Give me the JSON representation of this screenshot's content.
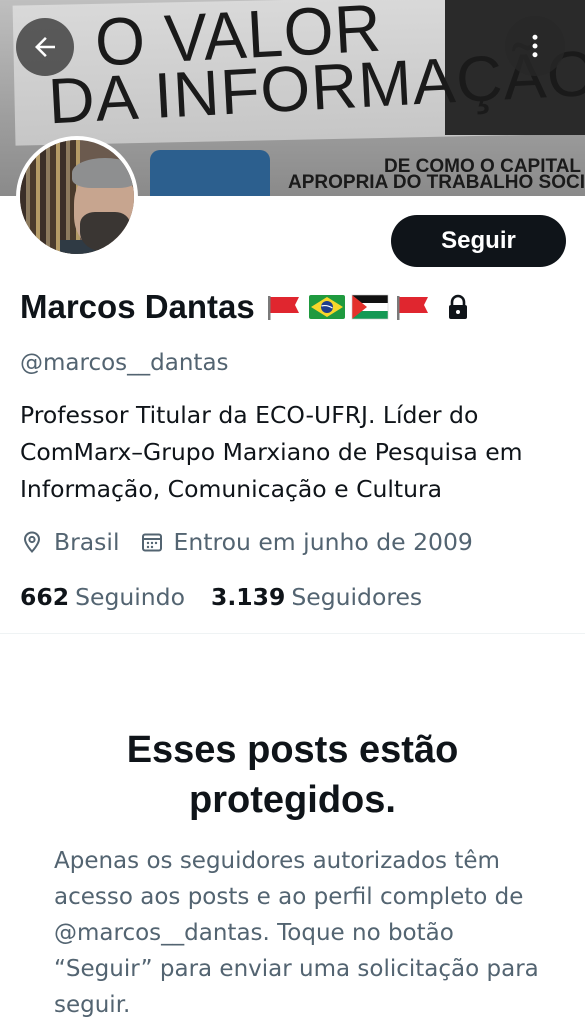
{
  "header": {
    "back_icon": "arrow-left-icon",
    "more_icon": "more-vertical-icon",
    "banner": {
      "line1": "O VALOR",
      "line2": "DA INFORMAÇÃO",
      "sub1": "DE COMO O CAPITAL SE",
      "sub2": "APROPRIA DO TRABALHO SOCIAL NA"
    }
  },
  "profile": {
    "follow_label": "Seguir",
    "name": "Marcos Dantas",
    "flags": [
      "red-flag",
      "brazil-flag",
      "palestine-flag",
      "red-flag"
    ],
    "protected_icon": "lock-icon",
    "handle": "@marcos__dantas",
    "bio": "Professor Titular da ECO-UFRJ. Líder do ComMarx–Grupo Marxiano de Pesquisa em Informação, Comunicação e Cultura",
    "location": "Brasil",
    "joined": "Entrou em junho de 2009",
    "following_count": "662",
    "following_label": "Seguindo",
    "followers_count": "3.139",
    "followers_label": "Seguidores"
  },
  "protected": {
    "title": "Esses posts estão protegidos.",
    "description": "Apenas os seguidores autorizados têm acesso aos posts e ao perfil completo de @marcos__dantas. Toque no botão “Seguir” para enviar uma solicitação para seguir."
  },
  "colors": {
    "text_primary": "#0f1419",
    "text_secondary": "#536471",
    "button_bg": "#0f1419"
  }
}
